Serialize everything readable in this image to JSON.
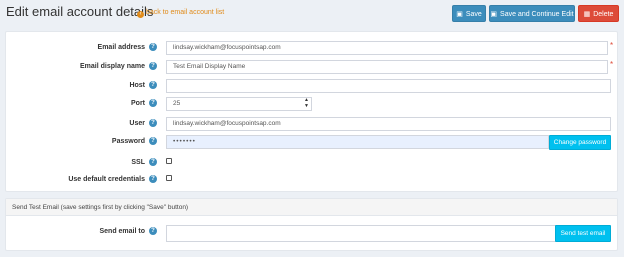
{
  "header": {
    "title": "Edit email account details",
    "back_link": "back to email account list",
    "save_label": "Save",
    "save_continue_label": "Save and Continue Edit",
    "delete_label": "Delete"
  },
  "form": {
    "email_address": {
      "label": "Email address",
      "value": "lindsay.wickham@focuspointsap.com",
      "required_mark": "*"
    },
    "display_name": {
      "label": "Email display name",
      "value": "Test Email Display Name",
      "required_mark": "*"
    },
    "host": {
      "label": "Host",
      "value": ""
    },
    "port": {
      "label": "Port",
      "value": "25"
    },
    "user": {
      "label": "User",
      "value": "lindsay.wickham@focuspointsap.com"
    },
    "password": {
      "label": "Password",
      "value": "•••••••",
      "change_label": "Change password"
    },
    "ssl": {
      "label": "SSL",
      "checked": false
    },
    "default_credentials": {
      "label": "Use default credentials",
      "checked": false
    }
  },
  "test_email": {
    "header": "Send Test Email (save settings first by clicking \"Save\" button)",
    "label": "Send email to",
    "value": "",
    "send_label": "Send test email"
  },
  "colors": {
    "primary": "#3c8dbc",
    "danger": "#dd4b39",
    "info": "#00c0ef",
    "link": "#e08b1a",
    "background": "#ecf0f5"
  },
  "icons": {
    "help": "?",
    "save": "floppy-disk-icon",
    "delete": "trash-icon",
    "back": "arrow-left-circle-icon"
  }
}
